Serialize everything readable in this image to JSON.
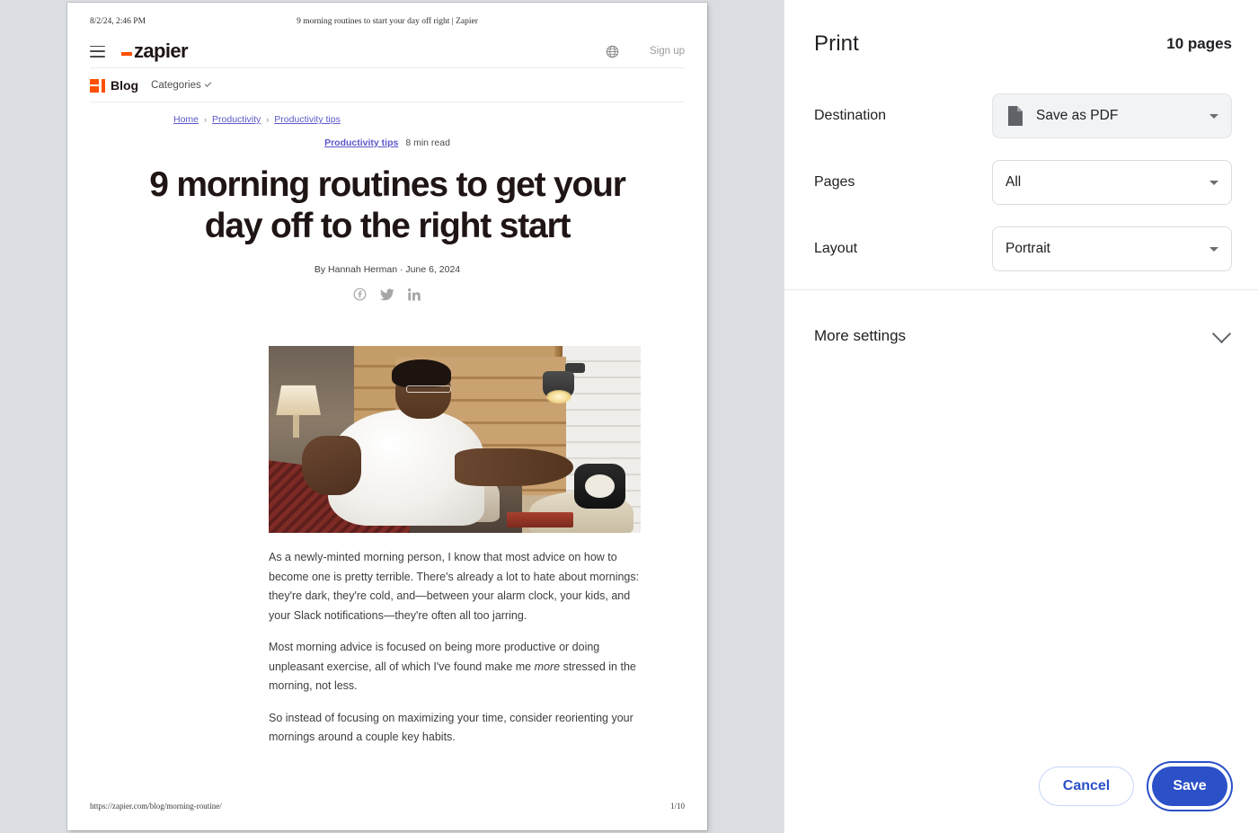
{
  "preview": {
    "print_header": {
      "date": "8/2/24, 2:46 PM",
      "doc_title": "9 morning routines to start your day off right | Zapier"
    },
    "site_header": {
      "logo_text": "zapier",
      "signup_label": "Sign up"
    },
    "blog_nav": {
      "blog_label": "Blog",
      "categories_label": "Categories"
    },
    "breadcrumb": [
      {
        "label": "Home"
      },
      {
        "label": "Productivity"
      },
      {
        "label": "Productivity tips"
      }
    ],
    "breadcrumb_separator": "›",
    "article": {
      "category_tag": "Productivity tips",
      "read_time": "8 min read",
      "headline": "9 morning routines to get your day off to the right start",
      "byline": "By Hannah Herman · June 6, 2024",
      "paragraphs": [
        "As a newly-minted morning person, I know that most advice on how to become one is pretty terrible. There's already a lot to hate about mornings: they're dark, they're cold, and—between your alarm clock, your kids, and your Slack notifications—they're often all too jarring.",
        "Most morning advice is focused on being more productive or doing unpleasant exercise, all of which I've found make me ",
        "more",
        " stressed in the morning, not less.",
        "So instead of focusing on maximizing your time, consider reorienting your mornings around a couple key habits."
      ],
      "hero_image_alt": "Man in white t-shirt sitting in bed reaching for an alarm clock on a nightstand"
    },
    "print_footer": {
      "url": "https://zapier.com/blog/morning-routine/",
      "page_number": "1/10"
    }
  },
  "dialog": {
    "title": "Print",
    "page_count": "10 pages",
    "settings": [
      {
        "label": "Destination",
        "value": "Save as PDF",
        "icon": "document-icon",
        "filled": true
      },
      {
        "label": "Pages",
        "value": "All",
        "filled": false
      },
      {
        "label": "Layout",
        "value": "Portrait",
        "filled": false
      }
    ],
    "more_settings_label": "More settings",
    "cancel_label": "Cancel",
    "save_label": "Save"
  },
  "colors": {
    "brand_orange": "#ff4f00",
    "accent_blue": "#2b50c8",
    "link_purple": "#5b58c8",
    "preview_bg": "#dadde1"
  }
}
